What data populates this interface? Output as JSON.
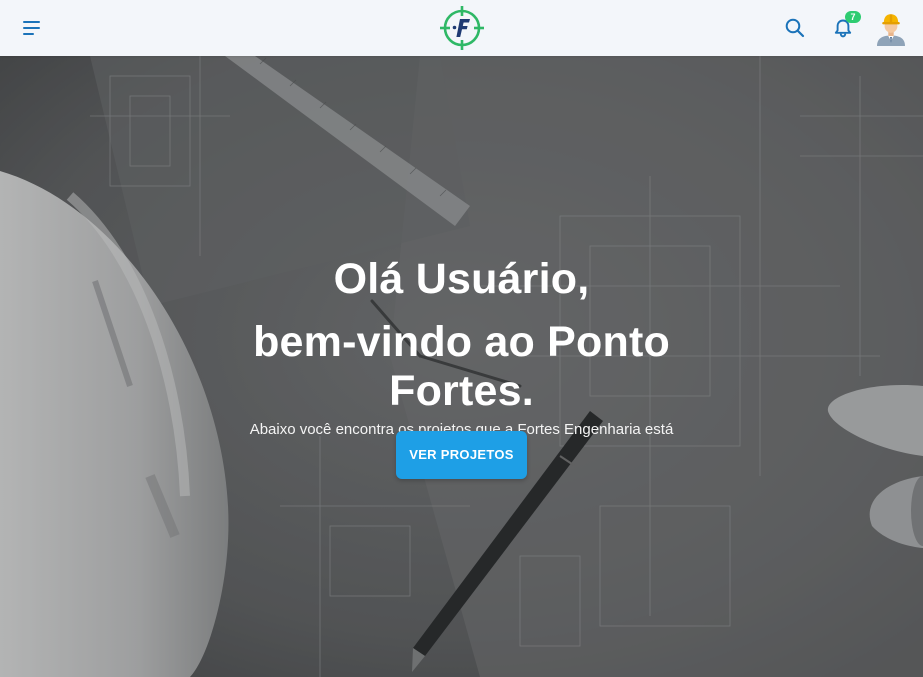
{
  "header": {
    "menu_icon": "hamburger-menu-icon",
    "logo_icon": "crosshair-f-logo",
    "search_icon": "search-icon",
    "bell_icon": "bell-icon",
    "notification_count": "7",
    "avatar_icon": "engineer-avatar-icon",
    "colors": {
      "bar_background": "#f3f6fa",
      "icon_blue": "#1b73b9",
      "logo_green": "#2fb866",
      "logo_navy": "#1f3a73",
      "badge_green": "#2ecc71"
    }
  },
  "hero": {
    "greeting": "Olá Usuário,",
    "welcome": "bem-vindo ao Ponto Fortes.",
    "subtitle": "Abaixo você encontra os projetos que a Fortes Engenharia está desenvolvendo!",
    "cta_label": "VER PROJETOS",
    "cta_color": "#1e9fe6",
    "background_description_icon": "blueprint-background"
  }
}
